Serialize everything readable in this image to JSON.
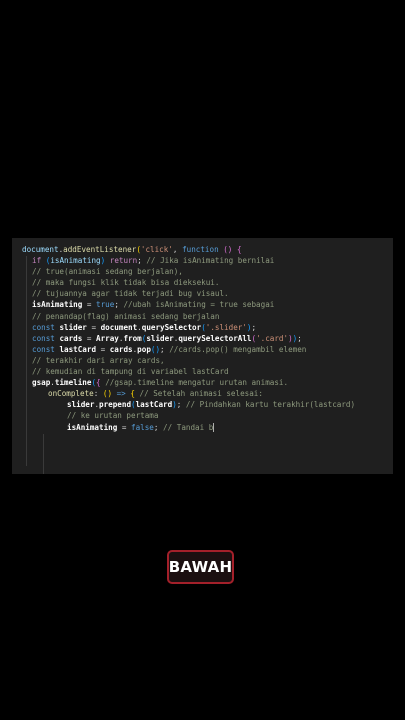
{
  "editor": {
    "lines": [
      {
        "tokens": [
          [
            "var",
            "document"
          ],
          [
            "pn",
            "."
          ],
          [
            "fn",
            "addEventListener"
          ],
          [
            "br1",
            "("
          ],
          [
            "str",
            "'click'"
          ],
          [
            "pn",
            ", "
          ],
          [
            "dc",
            "function"
          ],
          [
            "pn",
            " "
          ],
          [
            "br2",
            "()"
          ],
          [
            "pn",
            " "
          ],
          [
            "br2",
            "{"
          ]
        ]
      },
      {
        "tokens": [
          [
            "kw",
            "if"
          ],
          [
            "pn",
            " "
          ],
          [
            "br3",
            "("
          ],
          [
            "var",
            "isAnimating"
          ],
          [
            "br3",
            ")"
          ],
          [
            "pn",
            " "
          ],
          [
            "kw",
            "return"
          ],
          [
            "pn",
            "; "
          ],
          [
            "cm",
            "// Jika isAnimating bernilai"
          ]
        ]
      },
      {
        "tokens": [
          [
            "cm",
            "// true(animasi sedang berjalan),"
          ]
        ]
      },
      {
        "tokens": [
          [
            "cm",
            "// maka fungsi klik tidak bisa dieksekui."
          ]
        ]
      },
      {
        "tokens": [
          [
            "cm",
            "// tujuannya agar tidak terjadi bug visaul."
          ]
        ]
      },
      {
        "tokens": [
          [
            "bold",
            "isAnimating"
          ],
          [
            "pn",
            " = "
          ],
          [
            "dc",
            "true"
          ],
          [
            "pn",
            "; "
          ],
          [
            "cm",
            "//ubah isAnimating = true sebagai"
          ]
        ]
      },
      {
        "tokens": [
          [
            "cm",
            "// penandap(flag) animasi sedang berjalan"
          ]
        ]
      },
      {
        "tokens": [
          [
            "dc",
            "const"
          ],
          [
            "pn",
            " "
          ],
          [
            "bold",
            "slider"
          ],
          [
            "pn",
            " = "
          ],
          [
            "bold",
            "document"
          ],
          [
            "pn",
            "."
          ],
          [
            "bold",
            "querySelector"
          ],
          [
            "br3",
            "("
          ],
          [
            "str",
            "'.slider'"
          ],
          [
            "br3",
            ")"
          ],
          [
            "pn",
            ";"
          ]
        ]
      },
      {
        "tokens": [
          [
            "dc",
            "const"
          ],
          [
            "pn",
            " "
          ],
          [
            "bold",
            "cards"
          ],
          [
            "pn",
            " = "
          ],
          [
            "bold",
            "Array"
          ],
          [
            "pn",
            "."
          ],
          [
            "bold",
            "from"
          ],
          [
            "br3",
            "("
          ],
          [
            "bold",
            "slider"
          ],
          [
            "pn",
            "."
          ],
          [
            "bold",
            "querySelectorAll"
          ],
          [
            "br2",
            "("
          ],
          [
            "str",
            "'.card'"
          ],
          [
            "br2",
            ")"
          ],
          [
            "br3",
            ")"
          ],
          [
            "pn",
            ";"
          ]
        ]
      },
      {
        "tokens": [
          [
            "dc",
            "const"
          ],
          [
            "pn",
            " "
          ],
          [
            "bold",
            "lastCard"
          ],
          [
            "pn",
            " = "
          ],
          [
            "bold",
            "cards"
          ],
          [
            "pn",
            "."
          ],
          [
            "bold",
            "pop"
          ],
          [
            "br3",
            "()"
          ],
          [
            "pn",
            "; "
          ],
          [
            "cm",
            "//cards.pop() mengambil elemen"
          ]
        ]
      },
      {
        "tokens": [
          [
            "cm",
            "// terakhir dari array cards,"
          ]
        ]
      },
      {
        "tokens": [
          [
            "cm",
            "// kemudian di tampung di variabel lastCard"
          ]
        ]
      },
      {
        "tokens": [
          [
            "bold",
            "gsap"
          ],
          [
            "pn",
            "."
          ],
          [
            "bold",
            "timeline"
          ],
          [
            "br3",
            "("
          ],
          [
            "br2",
            "{"
          ],
          [
            "pn",
            " "
          ],
          [
            "cm",
            "//gsap.timeline mengatur urutan animasi."
          ]
        ]
      },
      {
        "tokens": [
          [
            "fn",
            "onComplete"
          ],
          [
            "pn",
            ": "
          ],
          [
            "br1",
            "()"
          ],
          [
            "pn",
            " "
          ],
          [
            "dc",
            "=>"
          ],
          [
            "pn",
            " "
          ],
          [
            "br1",
            "{"
          ],
          [
            "pn",
            " "
          ],
          [
            "cm",
            "// Setelah animasi selesai:"
          ]
        ]
      },
      {
        "tokens": [
          [
            "bold",
            "slider"
          ],
          [
            "pn",
            "."
          ],
          [
            "bold",
            "prepend"
          ],
          [
            "br3",
            "("
          ],
          [
            "bold",
            "lastCard"
          ],
          [
            "br3",
            ")"
          ],
          [
            "pn",
            "; "
          ],
          [
            "cm",
            "// Pindahkan kartu terakhir(lastcard)"
          ]
        ]
      },
      {
        "tokens": [
          [
            "cm",
            "// ke urutan pertama"
          ]
        ]
      },
      {
        "tokens": [
          [
            "bold",
            "isAnimating"
          ],
          [
            "pn",
            " = "
          ],
          [
            "dc",
            "false"
          ],
          [
            "pn",
            "; "
          ],
          [
            "cm",
            "// Tandai b"
          ]
        ]
      }
    ]
  },
  "badge": {
    "label": "BAWAH"
  }
}
